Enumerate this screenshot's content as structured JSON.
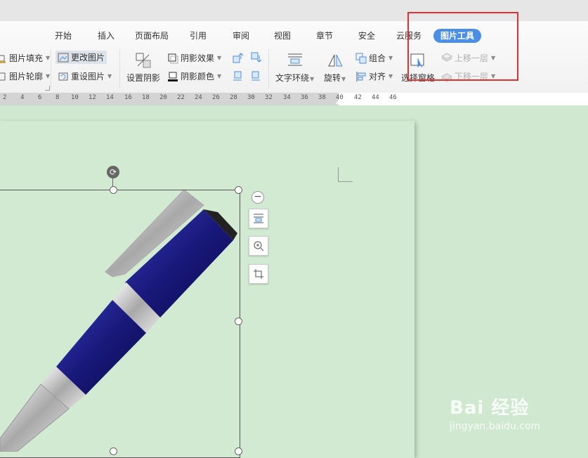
{
  "tabs": [
    "开始",
    "插入",
    "页面布局",
    "引用",
    "审阅",
    "视图",
    "章节",
    "安全",
    "云服务",
    "图片工具"
  ],
  "active_tab": "图片工具",
  "ribbon": {
    "fill": "图片填充",
    "outline": "图片轮廓",
    "change_pic": "更改图片",
    "reset_pic": "重设图片",
    "set_shadow": "设置阴影",
    "shadow_effect": "阴影效果",
    "shadow_color": "阴影颜色",
    "text_wrap": "文字环绕",
    "rotate": "旋转",
    "group": "组合",
    "align": "对齐",
    "selection_pane": "选择窗格",
    "bring_forward": "上移一层",
    "send_backward": "下移一层"
  },
  "ruler_numbers": [
    "2",
    "4",
    "6",
    "8",
    "10",
    "12",
    "14",
    "16",
    "18",
    "20",
    "22",
    "24",
    "26",
    "28",
    "30",
    "32",
    "34",
    "36",
    "38",
    "40",
    "42",
    "44",
    "46"
  ],
  "watermark": {
    "brand": "Bai 经验",
    "url": "jingyan.baidu.com"
  },
  "colors": {
    "accent": "#4a8fe7",
    "highlight": "#e03030",
    "canvas": "#cfe8cf"
  }
}
